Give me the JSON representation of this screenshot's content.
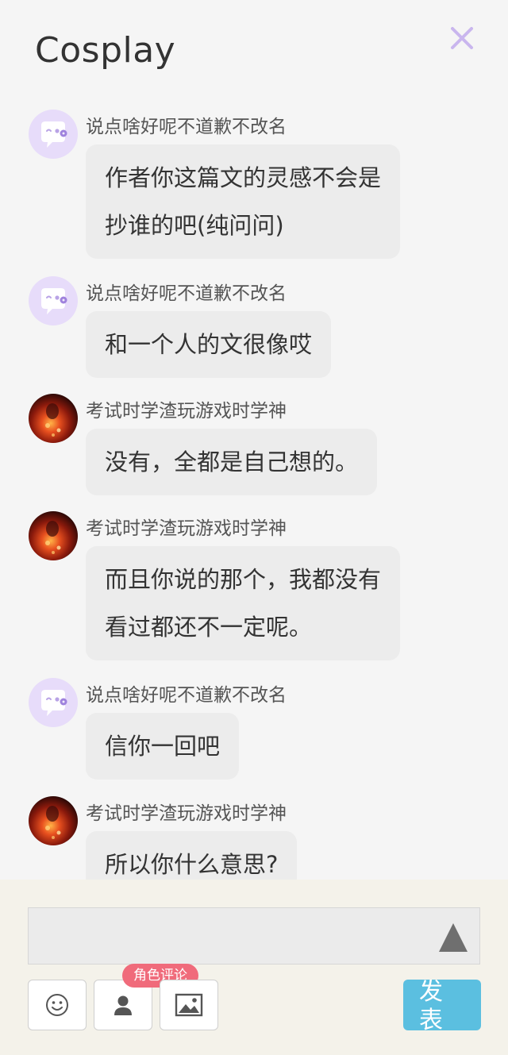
{
  "header": {
    "title": "Cosplay",
    "close_icon": "close-icon",
    "close_color": "#c9b6ee"
  },
  "messages": [
    {
      "avatar": "default-avatar",
      "name": "说点啥好呢不道歉不改名",
      "lines": [
        "作者你这篇文的灵感不会是",
        "抄谁的吧(纯问问)"
      ]
    },
    {
      "avatar": "default-avatar",
      "name": "说点啥好呢不道歉不改名",
      "lines": [
        "和一个人的文很像哎"
      ]
    },
    {
      "avatar": "photo-avatar",
      "name": "考试时学渣玩游戏时学神",
      "lines": [
        "没有，全都是自己想的。"
      ]
    },
    {
      "avatar": "photo-avatar",
      "name": "考试时学渣玩游戏时学神",
      "lines": [
        "而且你说的那个，我都没有",
        "看过都还不一定呢。"
      ]
    },
    {
      "avatar": "default-avatar",
      "name": "说点啥好呢不道歉不改名",
      "lines": [
        "信你一回吧"
      ]
    },
    {
      "avatar": "photo-avatar",
      "name": "考试时学渣玩游戏时学神",
      "lines": [
        "所以你什么意思?"
      ]
    }
  ],
  "composer": {
    "input_value": "",
    "send_icon": "send-triangle-icon",
    "tools": [
      "emoji-icon",
      "role-icon",
      "image-icon"
    ],
    "role_badge": "角色评论",
    "publish_label": "发表",
    "publish_color": "#5bbfe0"
  }
}
